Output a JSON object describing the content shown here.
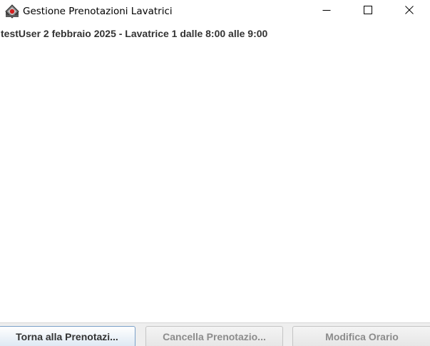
{
  "window": {
    "title": "Gestione Prenotazioni Lavatrici",
    "controls": {
      "minimize": "minimize-icon",
      "maximize": "maximize-icon",
      "close": "close-icon"
    }
  },
  "bookings": [
    "testUser 2 febbraio 2025 - Lavatrice 1 dalle 8:00 alle 9:00"
  ],
  "buttons": {
    "back": "Torna alla Prenotazi...",
    "cancel": "Cancella Prenotazio...",
    "modify": "Modifica Orario"
  },
  "colors": {
    "accent": "#7aa0c8",
    "disabled_text": "#8c8c8c",
    "text": "#333333"
  }
}
